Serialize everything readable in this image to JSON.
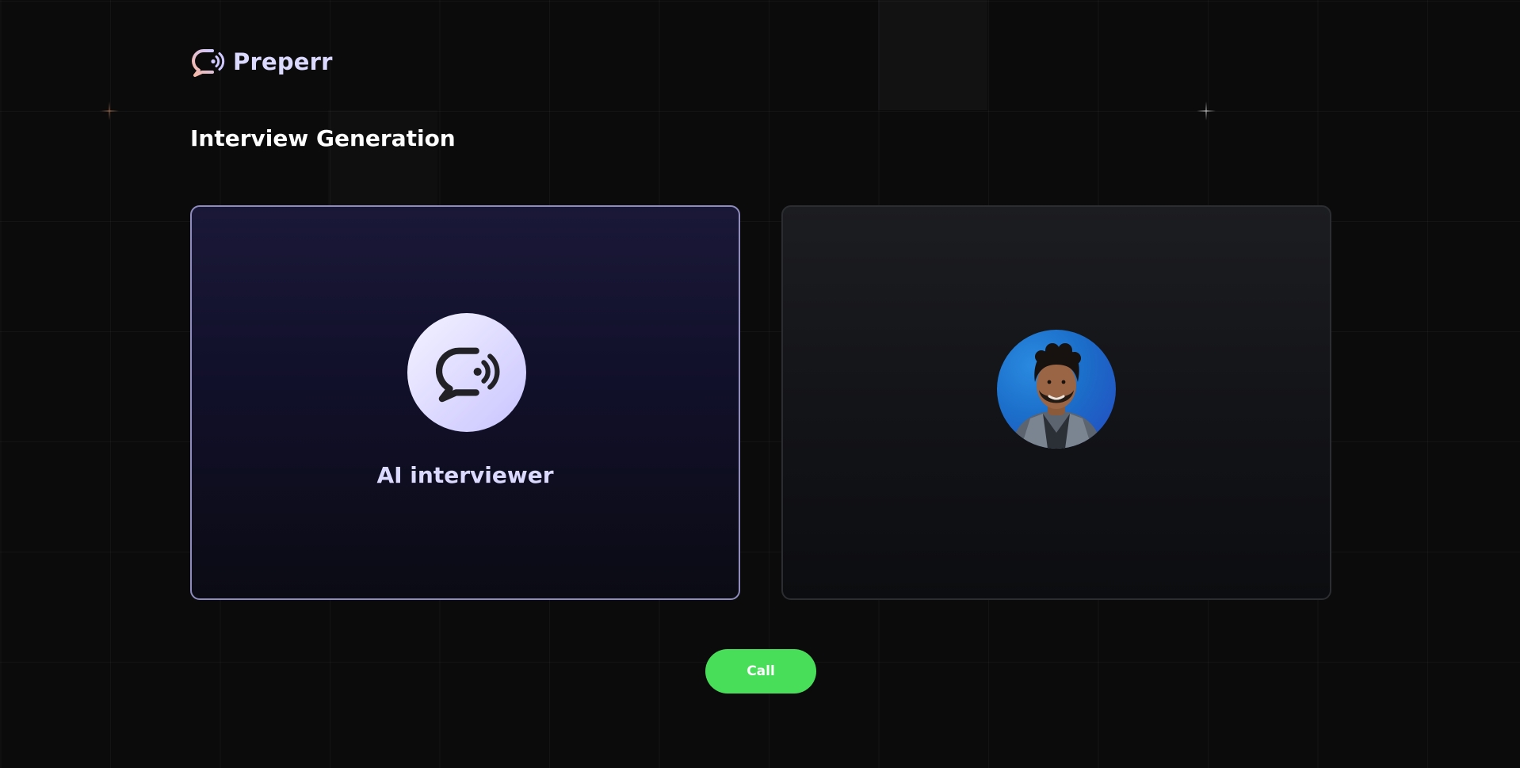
{
  "header": {
    "brand": "Preperr",
    "logo_icon": "chat-bubble-sound-icon"
  },
  "page_title": "Interview Generation",
  "cards": {
    "ai": {
      "label": "AI interviewer",
      "icon": "chat-bubble-sound-icon"
    },
    "user": {
      "avatar": "user-photo"
    }
  },
  "actions": {
    "call_label": "Call"
  },
  "colors": {
    "background": "#0b0b0c",
    "brand_text": "#dcd9ff",
    "ai_card_border": "#8f8bbd",
    "call_button": "#49de5a"
  }
}
